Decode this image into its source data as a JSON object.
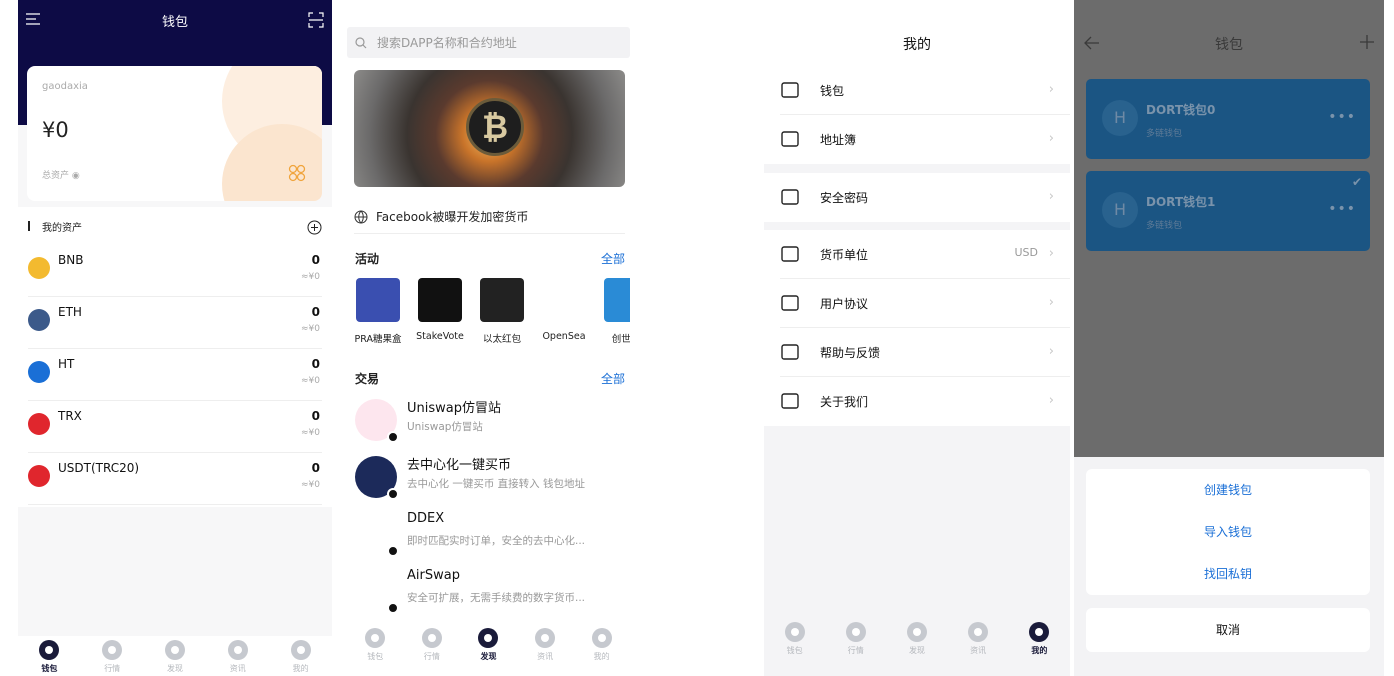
{
  "screen1": {
    "title": "钱包",
    "wallet_name": "gaodaxia",
    "balance": "¥0",
    "total_assets": "总资产",
    "section_title": "我的资产",
    "assets": [
      {
        "symbol": "BNB",
        "amount": "0",
        "fiat": "≈¥0",
        "color": "#f3ba2f"
      },
      {
        "symbol": "ETH",
        "amount": "0",
        "fiat": "≈¥0",
        "color": "#3c5a8a"
      },
      {
        "symbol": "HT",
        "amount": "0",
        "fiat": "≈¥0",
        "color": "#1a6fd6"
      },
      {
        "symbol": "TRX",
        "amount": "0",
        "fiat": "≈¥0",
        "color": "#e0262d"
      },
      {
        "symbol": "USDT(TRC20)",
        "amount": "0",
        "fiat": "≈¥0",
        "color": "#e0262d"
      }
    ],
    "tabs": [
      "钱包",
      "行情",
      "发现",
      "资讯",
      "我的"
    ]
  },
  "screen2": {
    "search_placeholder": "搜索DAPP名称和合约地址",
    "news": "Facebook被曝开发加密货币",
    "activities_title": "活动",
    "activities_all": "全部",
    "activities": [
      {
        "label": "PRA糖果盒",
        "color": "#3a4fb0"
      },
      {
        "label": "StakeVote",
        "color": "#111111"
      },
      {
        "label": "以太红包",
        "color": "#222222"
      },
      {
        "label": "OpenSea",
        "color": "#ffffff"
      },
      {
        "label": "创世纪",
        "color": "#2a8bd6"
      }
    ],
    "trade_title": "交易",
    "trade_all": "全部",
    "trades": [
      {
        "title": "Uniswap仿冒站",
        "sub": "Uniswap仿冒站",
        "color": "#fde6ee"
      },
      {
        "title": "去中心化一键买币",
        "sub": "去中心化 一键买币 直接转入 钱包地址",
        "color": "#1c2a5a"
      },
      {
        "title": "DDEX",
        "sub": "即时匹配实时订单，安全的去中心化...",
        "color": "#ffffff"
      },
      {
        "title": "AirSwap",
        "sub": "安全可扩展，无需手续费的数字货币...",
        "color": "#ffffff"
      }
    ],
    "tabs": [
      "钱包",
      "行情",
      "发现",
      "资讯",
      "我的"
    ]
  },
  "screen3": {
    "title": "我的",
    "items": [
      {
        "label": "钱包",
        "value": ""
      },
      {
        "label": "地址簿",
        "value": ""
      },
      {
        "label": "安全密码",
        "value": ""
      },
      {
        "label": "货币单位",
        "value": "USD"
      },
      {
        "label": "用户协议",
        "value": ""
      },
      {
        "label": "帮助与反馈",
        "value": ""
      },
      {
        "label": "关于我们",
        "value": ""
      }
    ],
    "tabs": [
      "钱包",
      "行情",
      "发现",
      "资讯",
      "我的"
    ]
  },
  "screen4": {
    "title": "钱包",
    "wallets": [
      {
        "name": "DORT钱包0",
        "type": "多链钱包"
      },
      {
        "name": "DORT钱包1",
        "type": "多链钱包"
      }
    ],
    "options": [
      "创建钱包",
      "导入钱包",
      "找回私钥"
    ],
    "cancel": "取消"
  }
}
